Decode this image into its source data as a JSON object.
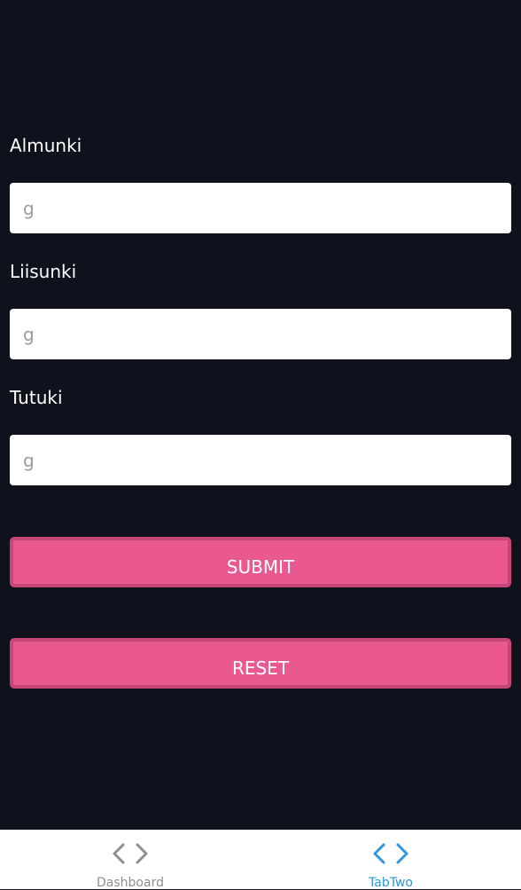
{
  "form": {
    "fields": [
      {
        "label": "Almunki",
        "placeholder": "g",
        "value": ""
      },
      {
        "label": "Liisunki",
        "placeholder": "g",
        "value": ""
      },
      {
        "label": "Tutuki",
        "placeholder": "g",
        "value": ""
      }
    ],
    "submit_label": "SUBMIT",
    "reset_label": "RESET"
  },
  "tabbar": {
    "tabs": [
      {
        "label": "Dashboard",
        "icon": "code-icon",
        "active": false
      },
      {
        "label": "TabTwo",
        "icon": "code-icon",
        "active": true
      }
    ]
  },
  "colors": {
    "background": "#0f121c",
    "button": "#ea5890",
    "button_border": "#c64775",
    "tab_active": "#2f95dc",
    "tab_inactive": "#8e8e8f"
  }
}
